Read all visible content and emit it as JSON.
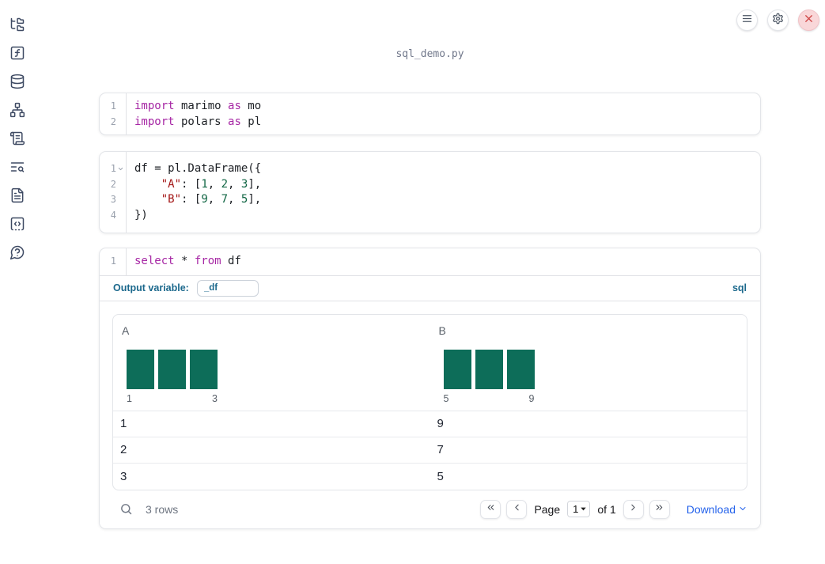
{
  "title": "sql_demo.py",
  "colors": {
    "sql_accent": "#1b688c",
    "histogram_bar": "#0d6d59",
    "keyword": "#a626a4",
    "string": "#a31515",
    "number": "#116644",
    "download_link": "#2563eb"
  },
  "sidebar": {
    "items": [
      {
        "name": "file-explorer",
        "icon": "folder-tree-icon"
      },
      {
        "name": "scratchpad",
        "icon": "function-square-icon"
      },
      {
        "name": "datasources",
        "icon": "database-icon"
      },
      {
        "name": "dependency-graph",
        "icon": "network-icon"
      },
      {
        "name": "logs",
        "icon": "scroll-icon"
      },
      {
        "name": "documentation",
        "icon": "text-search-icon"
      },
      {
        "name": "snippets",
        "icon": "file-text-icon"
      },
      {
        "name": "outline",
        "icon": "code-square-icon"
      },
      {
        "name": "help",
        "icon": "help-chat-icon"
      }
    ]
  },
  "topbar": {
    "buttons": [
      {
        "name": "menu",
        "icon": "menu-icon"
      },
      {
        "name": "settings",
        "icon": "gear-icon"
      },
      {
        "name": "close",
        "icon": "close-icon"
      }
    ]
  },
  "cells": {
    "imports": {
      "lines": [
        {
          "num": "1",
          "tokens": [
            {
              "t": "kw",
              "v": "import"
            },
            {
              "t": "txt",
              "v": " marimo "
            },
            {
              "t": "kw",
              "v": "as"
            },
            {
              "t": "txt",
              "v": " mo"
            }
          ]
        },
        {
          "num": "2",
          "tokens": [
            {
              "t": "kw",
              "v": "import"
            },
            {
              "t": "txt",
              "v": " polars "
            },
            {
              "t": "kw",
              "v": "as"
            },
            {
              "t": "txt",
              "v": " pl"
            }
          ]
        }
      ]
    },
    "dataframe": {
      "lines": [
        {
          "num": "1",
          "fold": true,
          "tokens": [
            {
              "t": "txt",
              "v": "df = pl.DataFrame({"
            }
          ]
        },
        {
          "num": "2",
          "tokens": [
            {
              "t": "txt",
              "v": "    "
            },
            {
              "t": "str",
              "v": "\"A\""
            },
            {
              "t": "txt",
              "v": ": ["
            },
            {
              "t": "num",
              "v": "1"
            },
            {
              "t": "txt",
              "v": ", "
            },
            {
              "t": "num",
              "v": "2"
            },
            {
              "t": "txt",
              "v": ", "
            },
            {
              "t": "num",
              "v": "3"
            },
            {
              "t": "txt",
              "v": "],"
            }
          ]
        },
        {
          "num": "3",
          "tokens": [
            {
              "t": "txt",
              "v": "    "
            },
            {
              "t": "str",
              "v": "\"B\""
            },
            {
              "t": "txt",
              "v": ": ["
            },
            {
              "t": "num",
              "v": "9"
            },
            {
              "t": "txt",
              "v": ", "
            },
            {
              "t": "num",
              "v": "7"
            },
            {
              "t": "txt",
              "v": ", "
            },
            {
              "t": "num",
              "v": "5"
            },
            {
              "t": "txt",
              "v": "],"
            }
          ]
        },
        {
          "num": "4",
          "tokens": [
            {
              "t": "txt",
              "v": "})"
            }
          ]
        }
      ]
    },
    "sql": {
      "lines": [
        {
          "num": "1",
          "tokens": [
            {
              "t": "kw",
              "v": "select"
            },
            {
              "t": "txt",
              "v": " * "
            },
            {
              "t": "kw",
              "v": "from"
            },
            {
              "t": "txt",
              "v": " df"
            }
          ]
        }
      ],
      "output_variable_label": "Output variable:",
      "output_variable_value": "_df",
      "language_badge": "sql"
    }
  },
  "table": {
    "columns": [
      {
        "name": "A",
        "hist": {
          "bars": [
            1,
            1,
            1
          ],
          "min_label": "1",
          "max_label": "3"
        }
      },
      {
        "name": "B",
        "hist": {
          "bars": [
            1,
            1,
            1
          ],
          "min_label": "5",
          "max_label": "9"
        }
      }
    ],
    "rows": [
      [
        "1",
        "9"
      ],
      [
        "2",
        "7"
      ],
      [
        "3",
        "5"
      ]
    ],
    "footer": {
      "row_count": "3 rows",
      "page_label": "Page",
      "page_value": "1",
      "of_label": "of 1",
      "download_label": "Download"
    }
  }
}
